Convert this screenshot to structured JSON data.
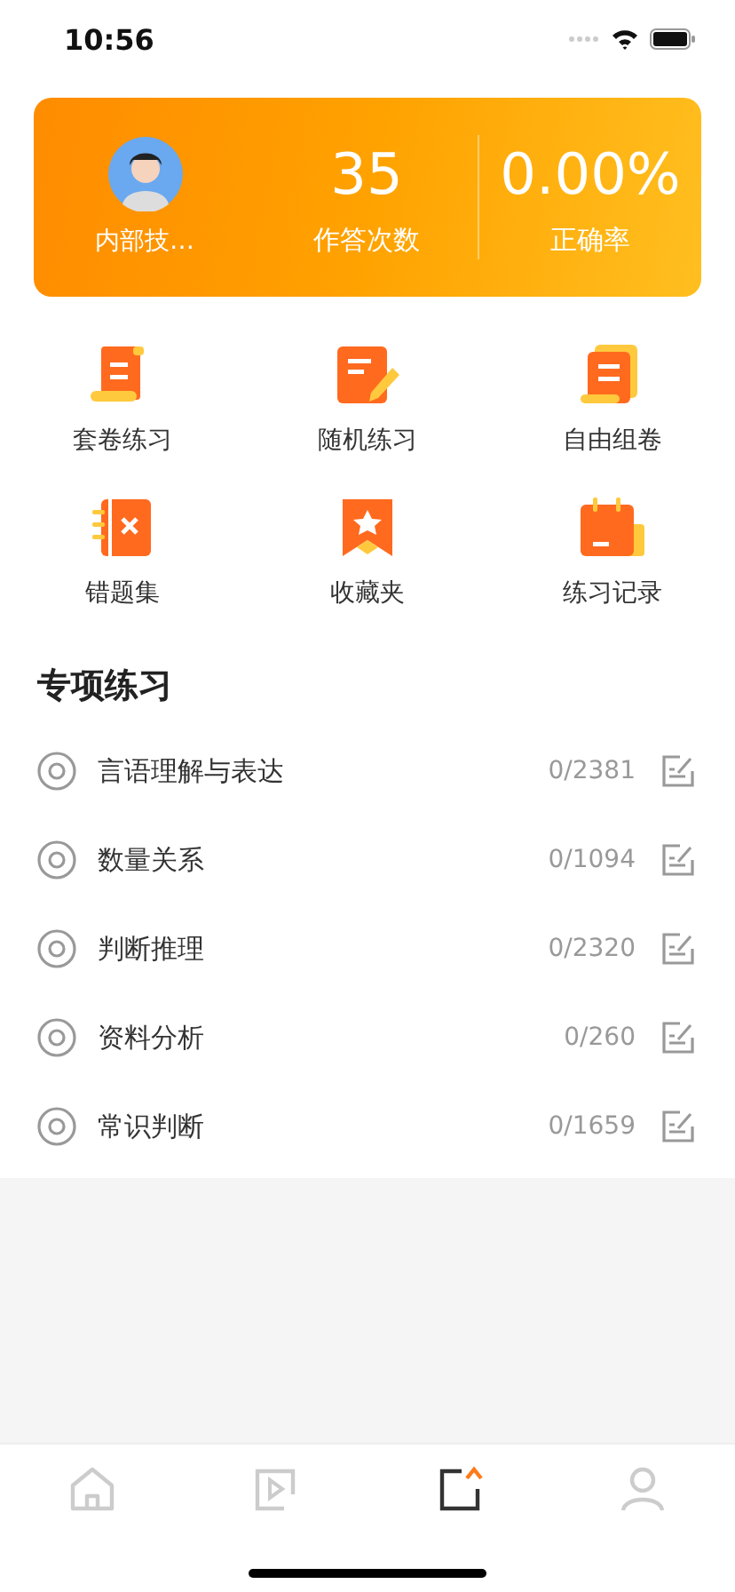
{
  "status_bar": {
    "time": "10:56"
  },
  "profile": {
    "name": "内部技…"
  },
  "stats": [
    {
      "value": "35",
      "label": "作答次数"
    },
    {
      "value": "0.00%",
      "label": "正确率"
    }
  ],
  "shortcuts": [
    {
      "kind": "scroll",
      "label": "套卷练习"
    },
    {
      "kind": "note",
      "label": "随机练习"
    },
    {
      "kind": "stack",
      "label": "自由组卷"
    },
    {
      "kind": "wrong",
      "label": "错题集"
    },
    {
      "kind": "bookmark",
      "label": "收藏夹"
    },
    {
      "kind": "calendar",
      "label": "练习记录"
    }
  ],
  "section": {
    "title": "专项练习",
    "items": [
      {
        "name": "言语理解与表达",
        "progress": "0/2381"
      },
      {
        "name": "数量关系",
        "progress": "0/1094"
      },
      {
        "name": "判断推理",
        "progress": "0/2320"
      },
      {
        "name": "资料分析",
        "progress": "0/260"
      },
      {
        "name": "常识判断",
        "progress": "0/1659"
      }
    ]
  },
  "tab_bar": [
    {
      "kind": "home",
      "selected": false
    },
    {
      "kind": "video",
      "selected": false
    },
    {
      "kind": "practice",
      "selected": true
    },
    {
      "kind": "profile",
      "selected": false
    }
  ]
}
